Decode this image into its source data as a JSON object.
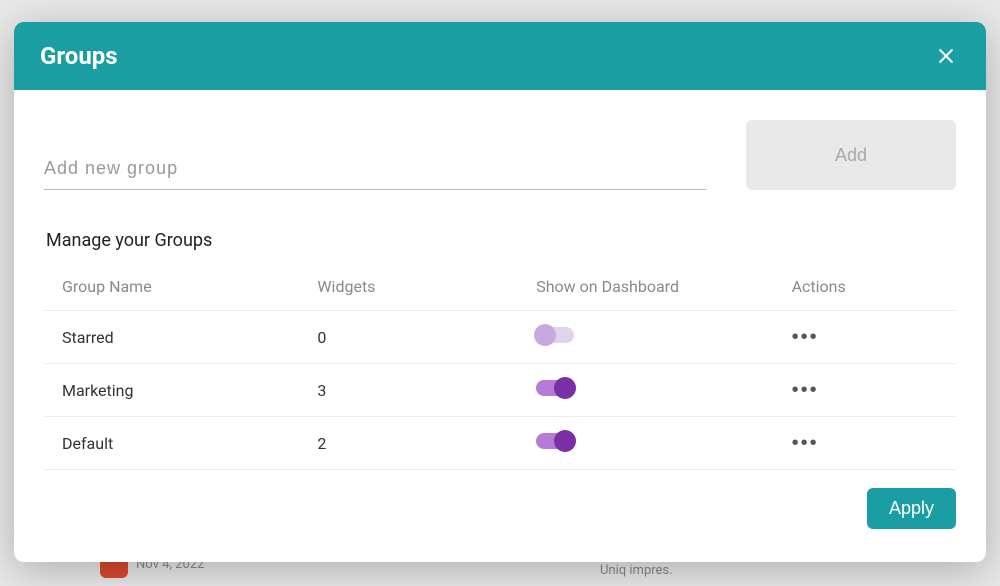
{
  "modal": {
    "title": "Groups",
    "add_input_placeholder": "Add new group",
    "add_button_label": "Add",
    "section_title": "Manage your Groups",
    "apply_button_label": "Apply"
  },
  "table": {
    "headers": {
      "name": "Group Name",
      "widgets": "Widgets",
      "show": "Show on Dashboard",
      "actions": "Actions"
    },
    "rows": [
      {
        "name": "Starred",
        "widgets": "0",
        "show_on_dashboard": false
      },
      {
        "name": "Marketing",
        "widgets": "3",
        "show_on_dashboard": true
      },
      {
        "name": "Default",
        "widgets": "2",
        "show_on_dashboard": true
      }
    ]
  },
  "background": {
    "date_hint": "Nov 4, 2022",
    "stat_hint": "Uniq impres."
  },
  "colors": {
    "accent": "#1a9da3",
    "toggle_on": "#7b2fa6"
  }
}
